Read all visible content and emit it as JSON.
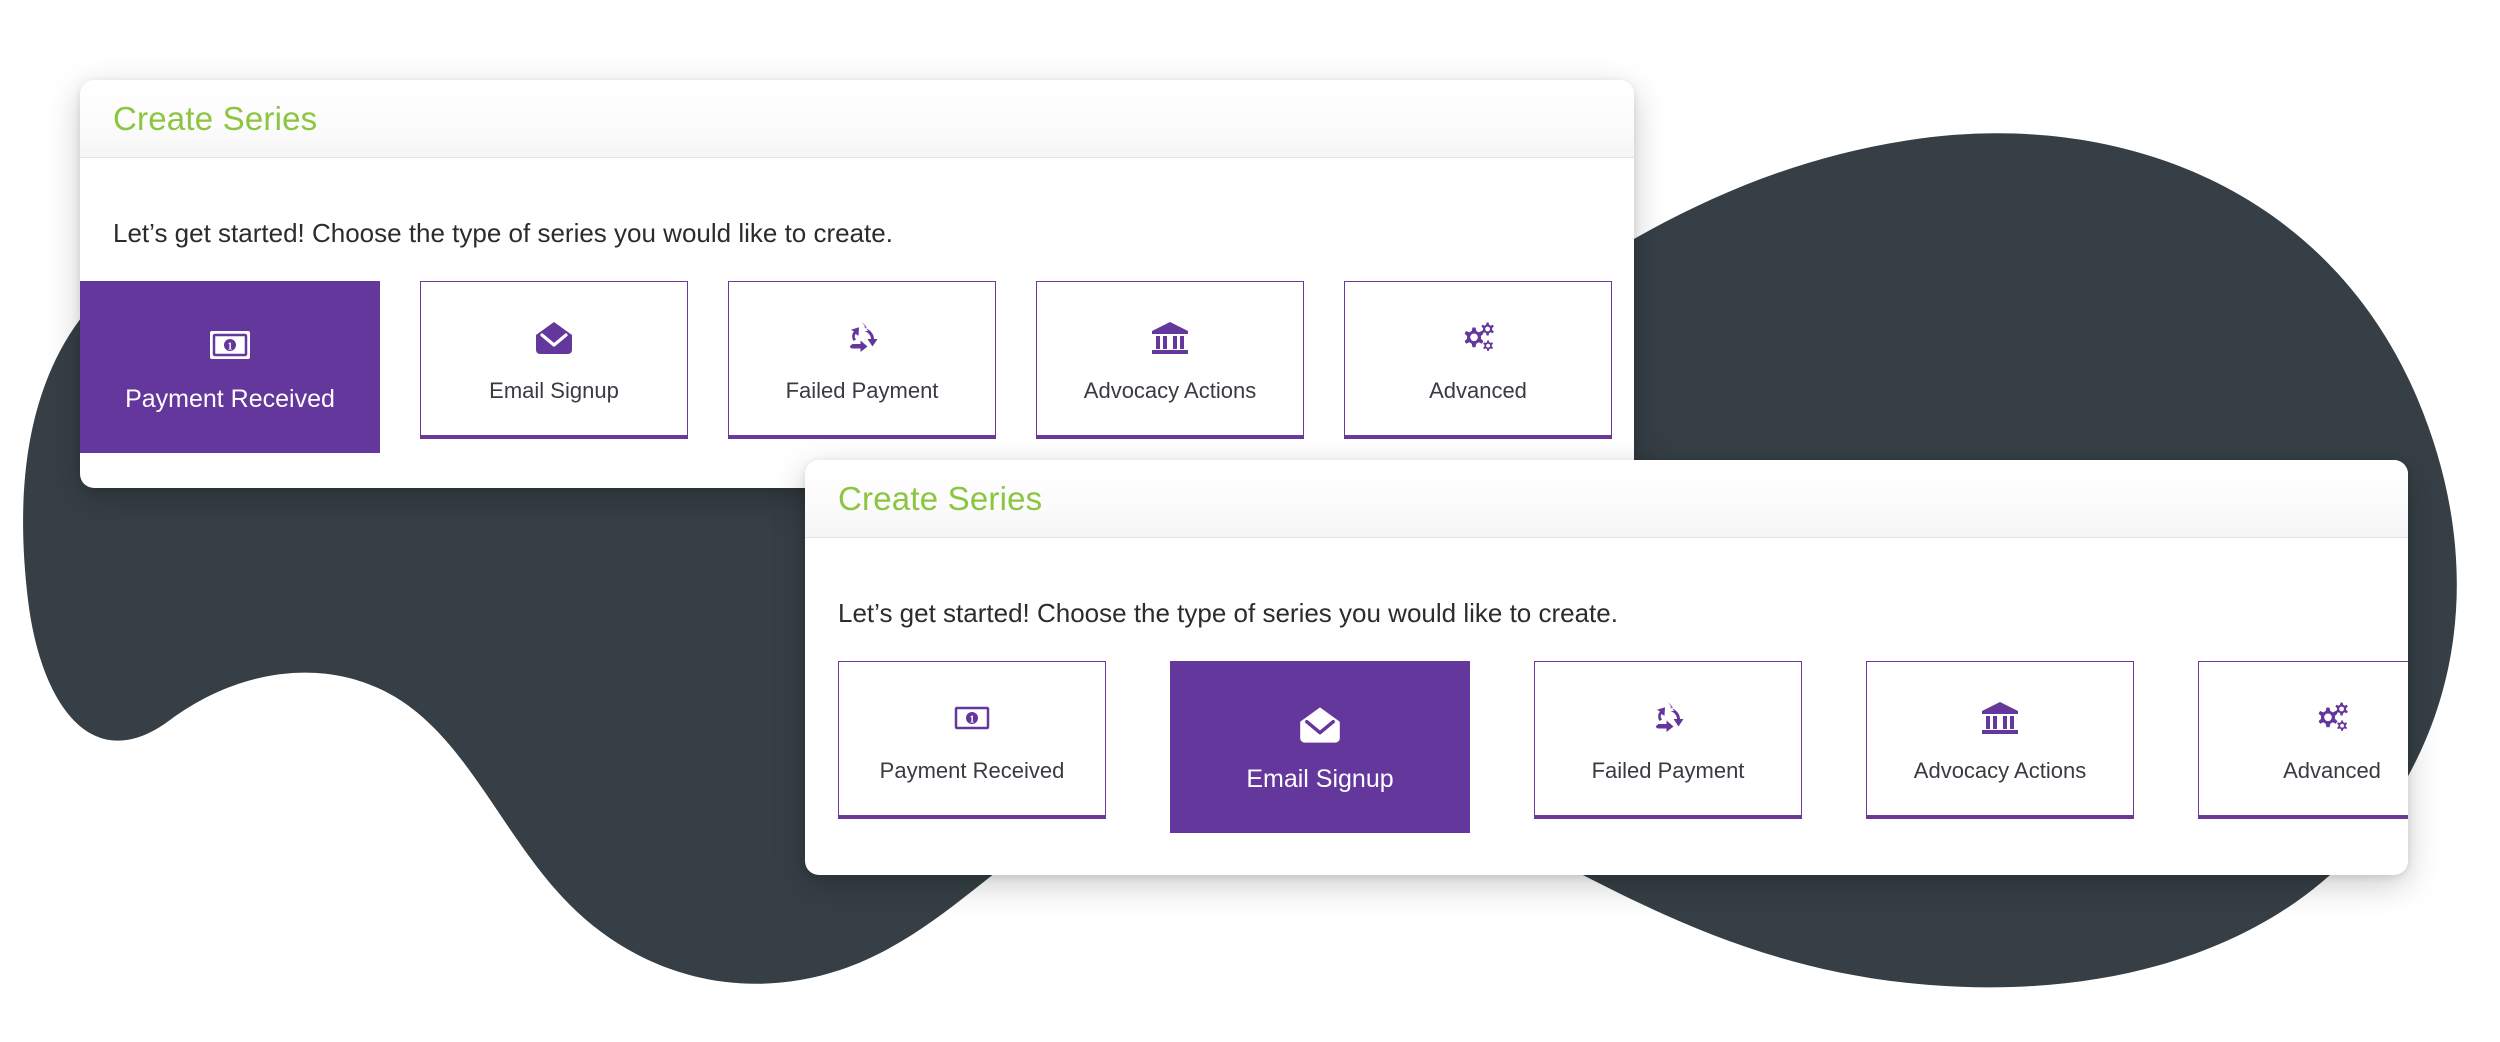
{
  "colors": {
    "brand_purple": "#63379b",
    "card_border_purple": "#6b3a99",
    "title_green": "#8cc540",
    "blob_dark": "#353f45",
    "panel_white": "#ffffff",
    "body_text": "#2c2c2c",
    "card_label": "#3a3a42"
  },
  "background": {
    "shape_name": "decorative-wave-blob"
  },
  "panel_one": {
    "title": "Create Series",
    "lead_text": "Let’s get started! Choose the type of series you would like to create.",
    "selected_index": 0,
    "cards": [
      {
        "label": "Payment Received",
        "icon": "money-bill-icon"
      },
      {
        "label": "Email Signup",
        "icon": "envelope-open-icon"
      },
      {
        "label": "Failed Payment",
        "icon": "recycle-icon"
      },
      {
        "label": "Advocacy Actions",
        "icon": "bank-icon"
      },
      {
        "label": "Advanced",
        "icon": "gears-icon"
      }
    ]
  },
  "panel_two": {
    "title": "Create Series",
    "lead_text": "Let’s get started! Choose the type of series you would like to create.",
    "selected_index": 1,
    "cards": [
      {
        "label": "Payment Received",
        "icon": "money-bill-icon"
      },
      {
        "label": "Email Signup",
        "icon": "envelope-open-icon"
      },
      {
        "label": "Failed Payment",
        "icon": "recycle-icon"
      },
      {
        "label": "Advocacy Actions",
        "icon": "bank-icon"
      },
      {
        "label": "Advanced",
        "icon": "gears-icon"
      }
    ]
  }
}
